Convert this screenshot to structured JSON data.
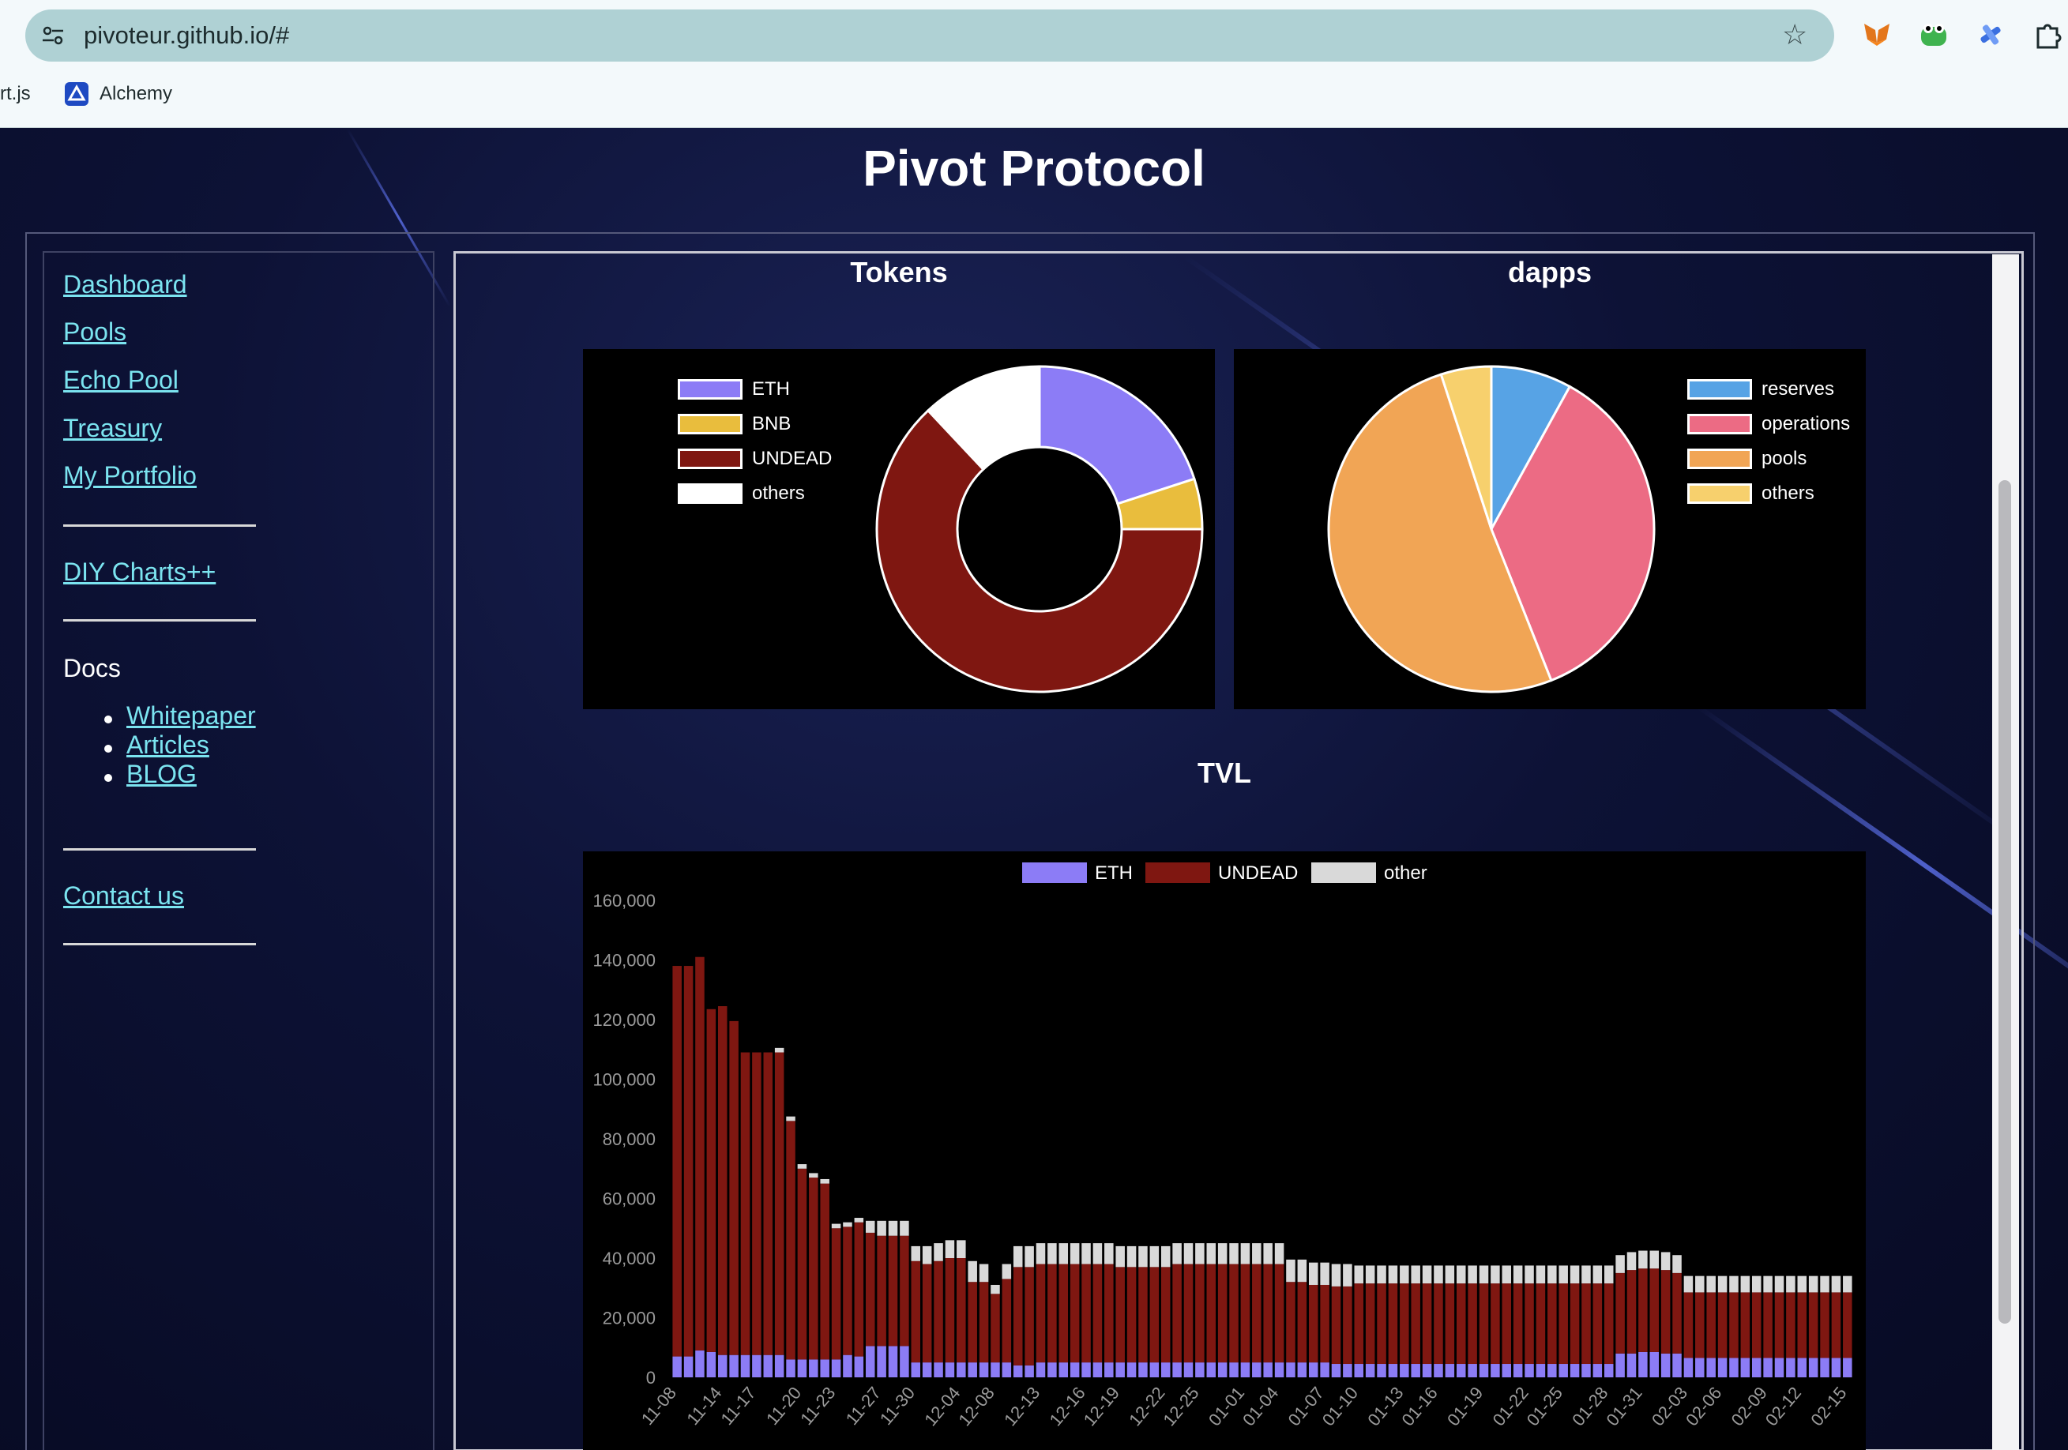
{
  "browser": {
    "url": "pivoteur.github.io/#",
    "bookmarks": [
      "rt.js",
      "Alchemy"
    ]
  },
  "page": {
    "title": "Pivot Protocol"
  },
  "sidebar": {
    "links": [
      "Dashboard",
      "Pools",
      "Echo Pool",
      "Treasury",
      "My Portfolio"
    ],
    "diy": "DIY Charts++",
    "docs_label": "Docs",
    "docs": [
      "Whitepaper",
      "Articles",
      "BLOG"
    ],
    "contact": "Contact us"
  },
  "sections": {
    "tokens_title": "Tokens",
    "dapps_title": "dapps",
    "tvl_title": "TVL"
  },
  "colors": {
    "eth": "#8c7cf6",
    "bnb": "#e9bd3d",
    "undead": "#7f1711",
    "others_white": "#ffffff",
    "reserves": "#57a3e5",
    "operations": "#ec6b84",
    "pools": "#f1a555",
    "dapps_others": "#f7d06d",
    "tvl_other": "#d9d9d9",
    "link": "#7be4f0"
  },
  "chart_data": [
    {
      "type": "pie",
      "variant": "doughnut",
      "title": "Tokens",
      "legend_position": "left",
      "categories": [
        "ETH",
        "BNB",
        "UNDEAD",
        "others"
      ],
      "values": [
        20,
        5,
        63,
        12
      ]
    },
    {
      "type": "pie",
      "title": "dapps",
      "legend_position": "right",
      "categories": [
        "reserves",
        "operations",
        "pools",
        "others"
      ],
      "values": [
        8,
        36,
        51,
        5
      ]
    },
    {
      "type": "bar",
      "stacked": true,
      "title": "TVL",
      "legend_position": "top",
      "ylim": [
        0,
        160000
      ],
      "yticks": [
        "0",
        "20,000",
        "40,000",
        "60,000",
        "80,000",
        "100,000",
        "120,000",
        "140,000",
        "160,000"
      ],
      "xtick_labels": [
        "11-08",
        "11-14",
        "11-17",
        "11-20",
        "11-23",
        "11-27",
        "11-30",
        "12-04",
        "12-08",
        "12-13",
        "12-16",
        "12-19",
        "12-22",
        "12-25",
        "01-01",
        "01-04",
        "01-07",
        "01-10",
        "01-13",
        "01-16",
        "01-19",
        "01-22",
        "01-25",
        "01-28",
        "01-31",
        "02-03",
        "02-06",
        "02-09",
        "02-12",
        "02-15"
      ],
      "series": [
        {
          "name": "ETH",
          "values": [
            7000,
            7000,
            9000,
            8500,
            7500,
            7500,
            7500,
            7500,
            7500,
            7500,
            6000,
            6000,
            6000,
            6000,
            6000,
            7500,
            7000,
            10500,
            10500,
            10500,
            10500,
            5000,
            5000,
            5000,
            5000,
            5000,
            5000,
            5000,
            5000,
            5000,
            4000,
            4000,
            5000,
            5000,
            5000,
            5000,
            5000,
            5000,
            5000,
            5000,
            5000,
            5000,
            5000,
            5000,
            5000,
            5000,
            5000,
            5000,
            5000,
            5000,
            5000,
            5000,
            5000,
            5000,
            5000,
            5000,
            5000,
            5000,
            4500,
            4500,
            4500,
            4500,
            4500,
            4500,
            4500,
            4500,
            4500,
            4500,
            4500,
            4500,
            4500,
            4500,
            4500,
            4500,
            4500,
            4500,
            4500,
            4500,
            4500,
            4500,
            4500,
            4500,
            4500,
            8000,
            8000,
            8500,
            8500,
            8000,
            8000,
            6500,
            6500,
            6500,
            6500,
            6500,
            6500,
            6500,
            6500,
            6500,
            6500,
            6500,
            6500,
            6500,
            6500,
            6500
          ]
        },
        {
          "name": "UNDEAD",
          "values": [
            131000,
            131000,
            132000,
            115000,
            117000,
            112000,
            101500,
            101500,
            101500,
            101500,
            80000,
            64000,
            61000,
            59000,
            44000,
            43000,
            45000,
            38000,
            37000,
            37000,
            37000,
            34000,
            33000,
            34000,
            35000,
            35000,
            27000,
            27000,
            23000,
            28000,
            33000,
            33000,
            33000,
            33000,
            33000,
            33000,
            33000,
            33000,
            33000,
            32000,
            32000,
            32000,
            32000,
            32000,
            33000,
            33000,
            33000,
            33000,
            33000,
            33000,
            33000,
            33000,
            33000,
            33000,
            27000,
            27000,
            26000,
            26000,
            26000,
            26000,
            27000,
            27000,
            27000,
            27000,
            27000,
            27000,
            27000,
            27000,
            27000,
            27000,
            27000,
            27000,
            27000,
            27000,
            27000,
            27000,
            27000,
            27000,
            27000,
            27000,
            27000,
            27000,
            27000,
            27000,
            28000,
            28000,
            28000,
            28000,
            27000,
            22000,
            22000,
            22000,
            22000,
            22000,
            22000,
            22000,
            22000,
            22000,
            22000,
            22000,
            22000,
            22000,
            22000,
            22000
          ]
        },
        {
          "name": "other",
          "values": [
            0,
            0,
            0,
            0,
            0,
            0,
            0,
            0,
            0,
            1500,
            1500,
            1500,
            1500,
            1500,
            1500,
            1500,
            1500,
            4000,
            5000,
            5000,
            5000,
            5000,
            6000,
            6000,
            6000,
            6000,
            7000,
            6000,
            3000,
            5000,
            7000,
            7000,
            7000,
            7000,
            7000,
            7000,
            7000,
            7000,
            7000,
            7000,
            7000,
            7000,
            7000,
            7000,
            7000,
            7000,
            7000,
            7000,
            7000,
            7000,
            7000,
            7000,
            7000,
            7000,
            7500,
            7500,
            7500,
            7500,
            7500,
            7500,
            6000,
            6000,
            6000,
            6000,
            6000,
            6000,
            6000,
            6000,
            6000,
            6000,
            6000,
            6000,
            6000,
            6000,
            6000,
            6000,
            6000,
            6000,
            6000,
            6000,
            6000,
            6000,
            6000,
            6000,
            6000,
            6000,
            6000,
            6000,
            6000,
            5500,
            5500,
            5500,
            5500,
            5500,
            5500,
            5500,
            5500,
            5500,
            5500,
            5500,
            5500,
            5500,
            5500,
            5500
          ]
        }
      ]
    }
  ]
}
